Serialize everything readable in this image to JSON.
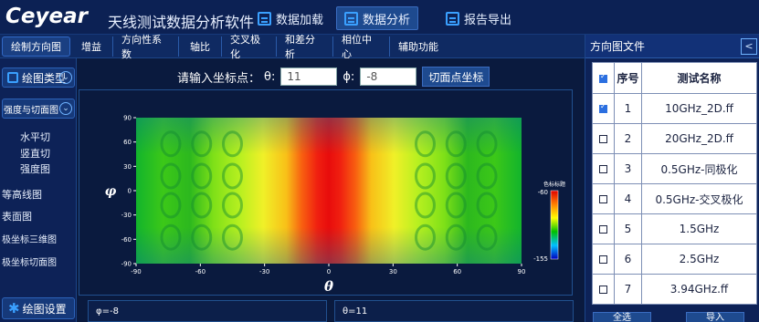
{
  "app": {
    "logo": "Ceyear",
    "title": "天线测试数据分析软件"
  },
  "top_tabs": [
    {
      "label": "数据加载"
    },
    {
      "label": "数据分析"
    },
    {
      "label": "报告导出"
    }
  ],
  "toolbar": {
    "items": [
      "绘制方向图",
      "增益",
      "方向性系数",
      "轴比",
      "交叉极化",
      "和差分析",
      "相位中心",
      "辅助功能"
    ]
  },
  "sidebar": {
    "plot_type": "绘图类型",
    "intensity_cut": "强度与切面图",
    "horizontal_cut": "水平切",
    "vertical_cut": "竖直切",
    "intensity_map": "强度图",
    "contour": "等高线图",
    "surface": "表面图",
    "polar_3d": "极坐标三维图",
    "polar_cut": "极坐标切面图",
    "plot_settings": "绘图设置"
  },
  "coord": {
    "prompt": "请输入坐标点：",
    "theta_label": "θ:",
    "theta_value": "11",
    "phi_label": "ϕ:",
    "phi_placeholder": "-8",
    "cut_button": "切面点坐标"
  },
  "chart_data": {
    "type": "heatmap",
    "xlabel": "θ",
    "ylabel": "φ",
    "x_ticks": [
      "-90",
      "-60",
      "-30",
      "0",
      "30",
      "60",
      "90"
    ],
    "y_ticks": [
      "90",
      "60",
      "30",
      "0",
      "-30",
      "-60",
      "-90"
    ],
    "xlim": [
      -90,
      90
    ],
    "ylim": [
      -90,
      90
    ],
    "colorbar": {
      "title": "色标标题",
      "max": "-60",
      "min": "-155"
    }
  },
  "bottom": {
    "phi_box": "φ=-8",
    "theta_box": "θ=11"
  },
  "file_panel": {
    "title": "方向图文件",
    "close": "<",
    "headers": {
      "index": "序号",
      "name": "测试名称"
    },
    "rows": [
      {
        "index": "1",
        "name": "10GHz_2D.ff",
        "checked": true
      },
      {
        "index": "2",
        "name": "20GHz_2D.ff",
        "checked": false
      },
      {
        "index": "3",
        "name": "0.5GHz-同极化",
        "checked": false
      },
      {
        "index": "4",
        "name": "0.5GHz-交叉极化",
        "checked": false
      },
      {
        "index": "5",
        "name": "1.5GHz",
        "checked": false
      },
      {
        "index": "6",
        "name": "2.5GHz",
        "checked": false
      },
      {
        "index": "7",
        "name": "3.94GHz.ff",
        "checked": false
      }
    ],
    "select_all": "全选",
    "import": "导入"
  },
  "colors": {
    "background": "#0a1a3e",
    "accent": "#3aa0ff",
    "active_tab": "#1e4a8f"
  }
}
